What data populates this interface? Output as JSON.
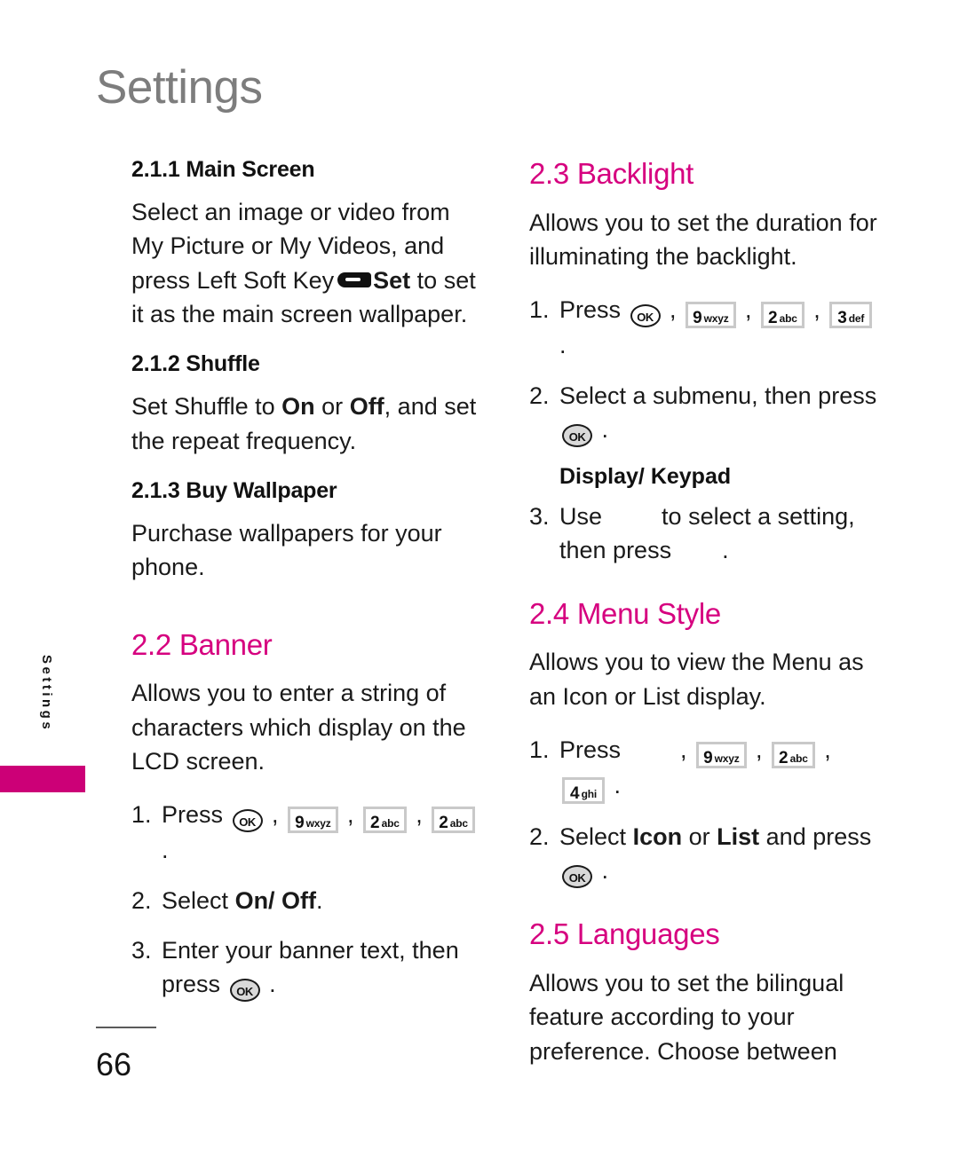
{
  "page": {
    "header_title": "Settings",
    "page_number": "66",
    "side_tab_label": "Settings",
    "accent_color": "#d6007f",
    "tab_color": "#cc0077",
    "header_color": "#7d7d7d"
  },
  "left_column": {
    "sub_2_1_1": {
      "heading": "2.1.1 Main Screen",
      "body_part1": "Select an image or video from My Picture or My Videos, and press Left Soft Key",
      "body_bold": "Set",
      "body_part2": "to set it as the main screen wallpaper."
    },
    "sub_2_1_2": {
      "heading": "2.1.2 Shuffle",
      "body_part1": "Set Shuffle to",
      "bold_on": "On",
      "body_mid": "or",
      "bold_off": "Off",
      "body_part2": ", and set the repeat frequency."
    },
    "sub_2_1_3": {
      "heading": "2.1.3 Buy Wallpaper",
      "body": "Purchase wallpapers for your phone."
    },
    "section_2_2": {
      "heading": "2.2 Banner",
      "intro": "Allows you to enter a string of characters which display on the LCD screen.",
      "steps": [
        {
          "num": "1.",
          "text_before": "Press",
          "keys": [
            {
              "type": "ok",
              "label": "OK",
              "style": "hollow"
            },
            {
              "type": "num",
              "digit": "9",
              "letters": "wxyz"
            },
            {
              "type": "num",
              "digit": "2",
              "letters": "abc"
            },
            {
              "type": "num",
              "digit": "2",
              "letters": "abc"
            }
          ],
          "text_after": "."
        },
        {
          "num": "2.",
          "text_before": "Select",
          "bold": "On/ Off",
          "text_after": "."
        },
        {
          "num": "3.",
          "text_before": "Enter your banner text, then press",
          "keys": [
            {
              "type": "ok",
              "label": "OK",
              "style": "filled"
            }
          ],
          "text_after": "."
        }
      ]
    }
  },
  "right_column": {
    "section_2_3": {
      "heading": "2.3 Backlight",
      "intro": "Allows you to set the duration for illuminating the backlight.",
      "step1": {
        "num": "1.",
        "text_before": "Press",
        "keys": [
          {
            "type": "ok",
            "label": "OK",
            "style": "hollow"
          },
          {
            "type": "num",
            "digit": "9",
            "letters": "wxyz"
          },
          {
            "type": "num",
            "digit": "2",
            "letters": "abc"
          },
          {
            "type": "num",
            "digit": "3",
            "letters": "def"
          }
        ],
        "text_after": "."
      },
      "step2": {
        "num": "2.",
        "text_before": "Select a submenu, then press",
        "keys": [
          {
            "type": "ok",
            "label": "OK",
            "style": "filled"
          }
        ],
        "text_after": "."
      },
      "subheading": "Display/ Keypad",
      "step3": {
        "num": "3.",
        "text_before": "Use",
        "text_mid": "to select a setting, then press",
        "text_after": "."
      }
    },
    "section_2_4": {
      "heading": "2.4 Menu Style",
      "intro": "Allows you to view the Menu as an Icon or List display.",
      "step1": {
        "num": "1.",
        "text_before": "Press",
        "keys": [
          {
            "type": "blank"
          },
          {
            "type": "num",
            "digit": "9",
            "letters": "wxyz"
          },
          {
            "type": "num",
            "digit": "2",
            "letters": "abc"
          },
          {
            "type": "num",
            "digit": "4",
            "letters": "ghi"
          }
        ],
        "text_after": "."
      },
      "step2": {
        "num": "2.",
        "text_before": "Select",
        "bold_icon": "Icon",
        "text_mid": "or",
        "bold_list": "List",
        "text_after2": "and press",
        "keys": [
          {
            "type": "ok",
            "label": "OK",
            "style": "filled"
          }
        ],
        "text_after": "."
      }
    },
    "section_2_5": {
      "heading": "2.5 Languages",
      "intro": "Allows you to set the bilingual feature according to your preference. Choose between"
    }
  }
}
